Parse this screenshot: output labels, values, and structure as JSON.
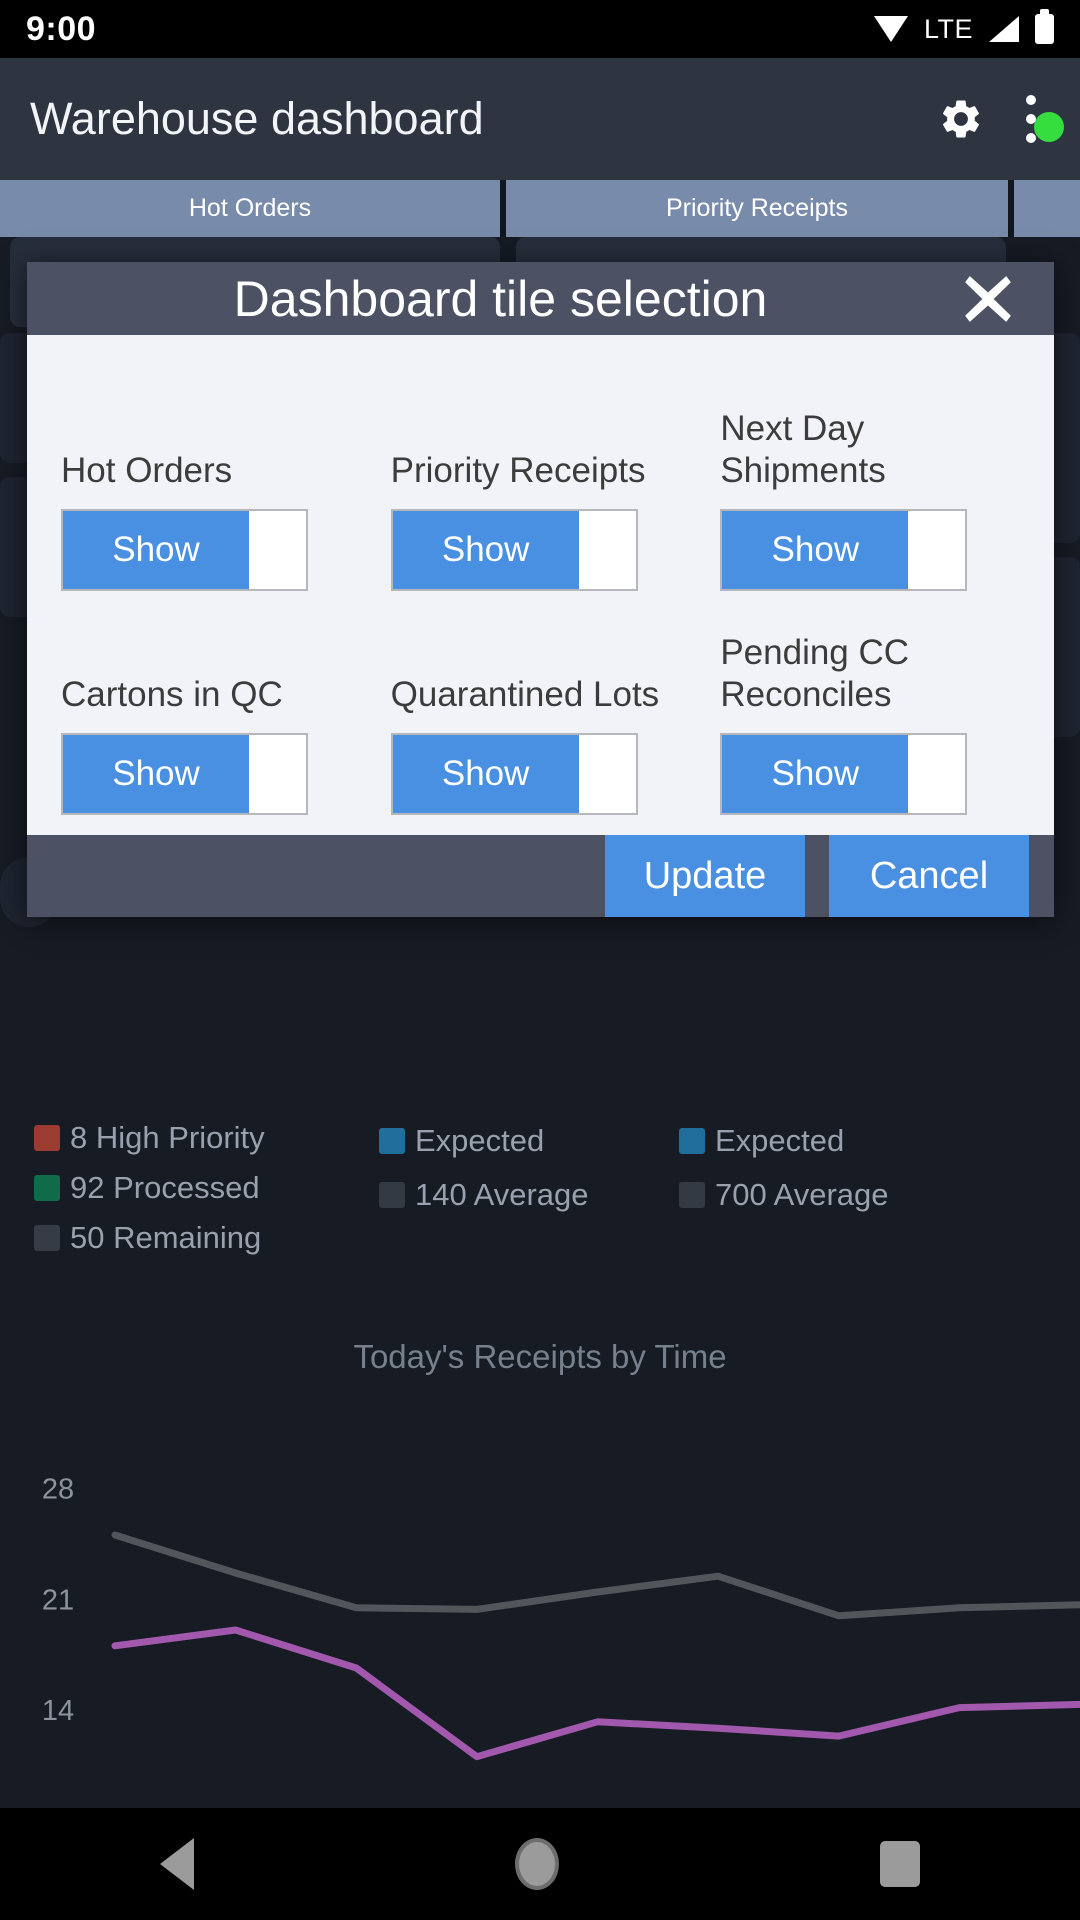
{
  "status_bar": {
    "time": "9:00",
    "network_label": "LTE",
    "icons": [
      "wifi-icon",
      "signal-icon",
      "battery-icon"
    ]
  },
  "app_bar": {
    "title": "Warehouse dashboard",
    "settings_icon": "gear-icon",
    "overflow_icon": "kebab-menu-icon",
    "status_indicator_color": "#35dd3f"
  },
  "tabs": [
    {
      "label": "Hot Orders"
    },
    {
      "label": "Priority Receipts"
    },
    {
      "label": ""
    }
  ],
  "dialog": {
    "title": "Dashboard tile selection",
    "close_icon": "close-icon",
    "tiles": [
      {
        "label": "Hot Orders",
        "toggle_label": "Show",
        "state": "on"
      },
      {
        "label": "Priority Receipts",
        "toggle_label": "Show",
        "state": "on"
      },
      {
        "label": "Next Day Shipments",
        "toggle_label": "Show",
        "state": "on"
      },
      {
        "label": "Cartons in QC",
        "toggle_label": "Show",
        "state": "on"
      },
      {
        "label": "Quarantined Lots",
        "toggle_label": "Show",
        "state": "on"
      },
      {
        "label": "Pending CC Reconciles",
        "toggle_label": "Show",
        "state": "on"
      }
    ],
    "update_label": "Update",
    "cancel_label": "Cancel",
    "accent_color": "#4a90e2"
  },
  "legend": {
    "columns": [
      {
        "items": [
          {
            "text": "8 High Priority",
            "color": "#9c3b2f"
          },
          {
            "text": "92 Processed",
            "color": "#0f6b4a"
          },
          {
            "text": "50 Remaining",
            "color": "#363c46"
          }
        ]
      },
      {
        "items": [
          {
            "text": "Expected",
            "color": "#1f6e9c"
          },
          {
            "text": "140 Average",
            "color": "#343a44"
          }
        ]
      },
      {
        "items": [
          {
            "text": "Expected",
            "color": "#1f6e9c"
          },
          {
            "text": "700 Average",
            "color": "#343a44"
          }
        ]
      }
    ]
  },
  "chart_data": {
    "type": "line",
    "title": "Today's Receipts by Time",
    "xlabel": "",
    "ylabel": "",
    "grid": false,
    "legend_position": "none",
    "ytick_labels": [
      "28",
      "21",
      "14"
    ],
    "ytick_values": [
      28,
      21,
      14
    ],
    "ylim": [
      7,
      31
    ],
    "x": [
      0,
      1,
      2,
      3,
      4,
      5,
      6,
      7,
      8
    ],
    "series": [
      {
        "name": "Receipts",
        "color": "#52565b",
        "values": [
          25.0,
          22.6,
          20.4,
          20.3,
          21.4,
          22.4,
          19.9,
          20.4,
          20.6
        ]
      },
      {
        "name": "Average",
        "color": "#a158ad",
        "values": [
          18.0,
          19.0,
          16.6,
          11.0,
          13.2,
          12.8,
          12.3,
          14.1,
          14.3
        ]
      }
    ]
  },
  "nav_bar": {
    "back_icon": "back-triangle-icon",
    "home_icon": "home-circle-icon",
    "recents_icon": "recents-square-icon"
  }
}
